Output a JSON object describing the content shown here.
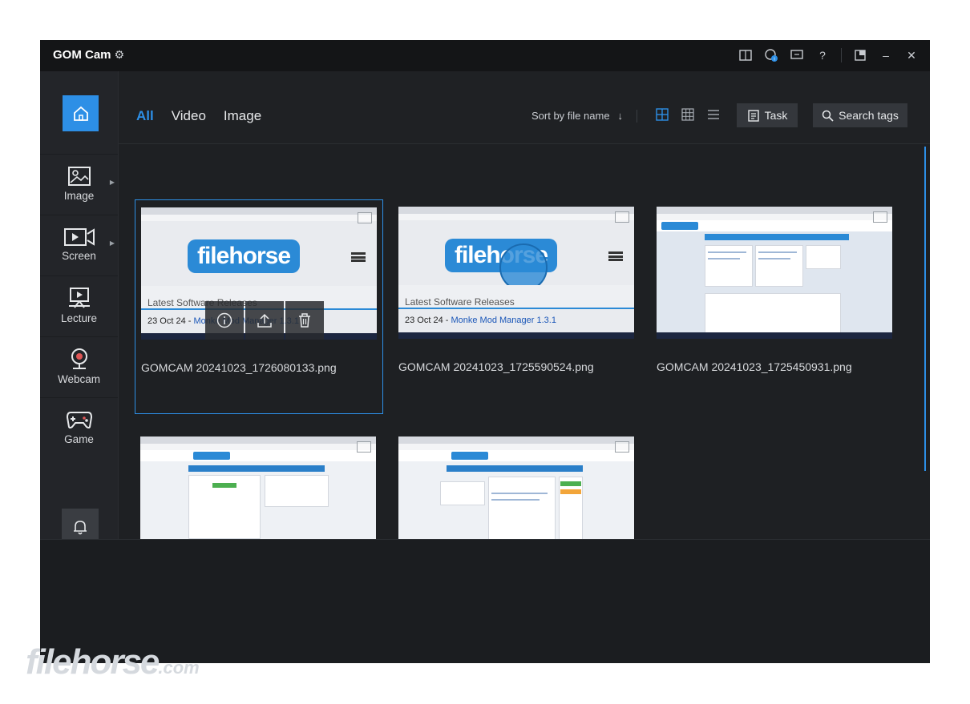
{
  "app": {
    "title": "GOM Cam"
  },
  "titlebar": {
    "help": "?",
    "minimize": "–",
    "close": "✕"
  },
  "sidebar": {
    "items": [
      {
        "label": "Image"
      },
      {
        "label": "Screen"
      },
      {
        "label": "Lecture"
      },
      {
        "label": "Webcam"
      },
      {
        "label": "Game"
      }
    ]
  },
  "filters": {
    "all": "All",
    "video": "Video",
    "image": "Image"
  },
  "sort": {
    "label": "Sort by file name",
    "arrow": "↓"
  },
  "buttons": {
    "task": "Task",
    "search_tags": "Search tags"
  },
  "files": [
    {
      "name": "GOMCAM 20241023_1726080133.png"
    },
    {
      "name": "GOMCAM 20241023_1725590524.png"
    },
    {
      "name": "GOMCAM 20241023_1725450931.png"
    },
    {
      "name": ""
    },
    {
      "name": ""
    }
  ],
  "thumb_text": {
    "logo": "filehorse",
    "latest_title": "Latest Software Releases",
    "latest_date": "23 Oct 24 -",
    "latest_item": "Monke Mod Manager 1.3.1"
  },
  "watermark": {
    "main": "filehorse",
    "suffix": ".com"
  },
  "colors": {
    "accent": "#2d8fe6",
    "background": "#1b1d20",
    "panel": "#232529"
  }
}
